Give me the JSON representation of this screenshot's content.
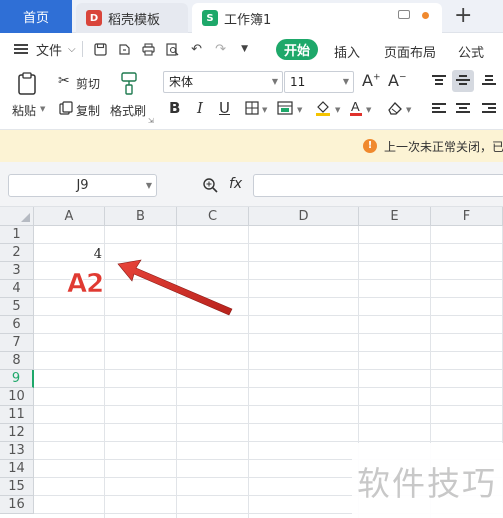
{
  "tabs": {
    "home": "首页",
    "template": "稻壳模板",
    "workbook": "工作簿1",
    "template_icon": "D",
    "workbook_icon": "S",
    "new_tab": "+"
  },
  "menubar": {
    "file": "文件",
    "start": "开始",
    "insert": "插入",
    "page_layout": "页面布局",
    "formula": "公式"
  },
  "ribbon": {
    "paste": "粘贴",
    "cut": "剪切",
    "copy": "复制",
    "format_painter": "格式刷",
    "font_name": "宋体",
    "font_size": "11",
    "bold": "B",
    "italic": "I",
    "underline": "U"
  },
  "notification": {
    "icon": "!",
    "text": "上一次未正常关闭，已"
  },
  "formula_bar": {
    "cell_ref": "J9",
    "fx": "fx",
    "value": ""
  },
  "sheet": {
    "columns": [
      "A",
      "B",
      "C",
      "D",
      "E",
      "F"
    ],
    "rows": [
      "1",
      "2",
      "3",
      "4",
      "5",
      "6",
      "7",
      "8",
      "9",
      "10",
      "11",
      "12",
      "13",
      "14",
      "15",
      "16"
    ],
    "selected_row": "9",
    "cell_A2": "4"
  },
  "annotation": {
    "label": "A2",
    "color": "#e03a32"
  },
  "watermark": "软件技巧",
  "colors": {
    "accent_green": "#1ea86a",
    "home_tab_blue": "#2f6fd6",
    "notification_bg": "#fcf3d4",
    "notification_icon": "#f0892e"
  }
}
